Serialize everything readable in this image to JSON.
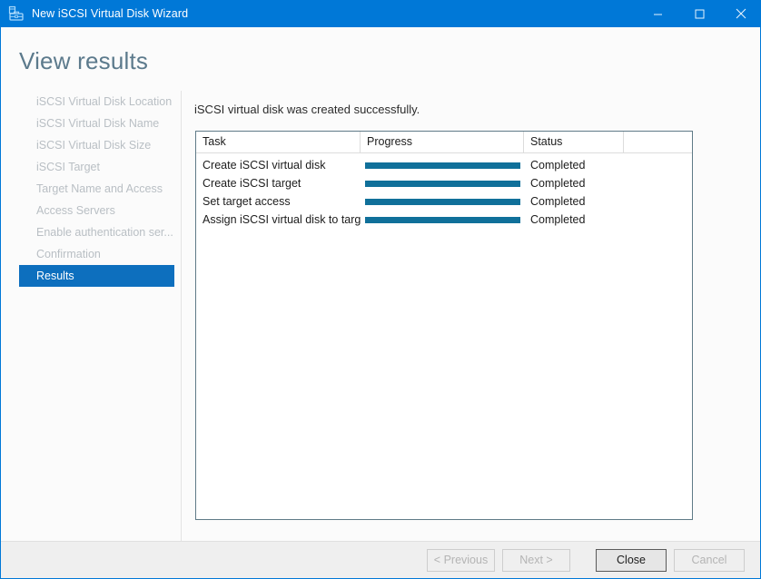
{
  "window": {
    "title": "New iSCSI Virtual Disk Wizard",
    "icon": "iscsi-virtual-disk-icon",
    "minimize_label": "Minimize",
    "maximize_label": "Maximize",
    "close_label": "Close",
    "accent_color": "#0078d7"
  },
  "page": {
    "title": "View results"
  },
  "nav": {
    "items": [
      {
        "label": "iSCSI Virtual Disk Location",
        "selected": false
      },
      {
        "label": "iSCSI Virtual Disk Name",
        "selected": false
      },
      {
        "label": "iSCSI Virtual Disk Size",
        "selected": false
      },
      {
        "label": "iSCSI Target",
        "selected": false
      },
      {
        "label": "Target Name and Access",
        "selected": false
      },
      {
        "label": "Access Servers",
        "selected": false
      },
      {
        "label": "Enable authentication ser...",
        "selected": false
      },
      {
        "label": "Confirmation",
        "selected": false
      },
      {
        "label": "Results",
        "selected": true
      }
    ],
    "selected_color": "#0d6fbe"
  },
  "content": {
    "message": "iSCSI virtual disk was created successfully.",
    "table": {
      "columns": [
        "Task",
        "Progress",
        "Status",
        ""
      ],
      "progress_color": "#10709a",
      "rows": [
        {
          "task": "Create iSCSI virtual disk",
          "progress": 100,
          "status": "Completed",
          "extra": ""
        },
        {
          "task": "Create iSCSI target",
          "progress": 100,
          "status": "Completed",
          "extra": ""
        },
        {
          "task": "Set target access",
          "progress": 100,
          "status": "Completed",
          "extra": ""
        },
        {
          "task": "Assign iSCSI virtual disk to target",
          "progress": 100,
          "status": "Completed",
          "extra": ""
        }
      ]
    }
  },
  "footer": {
    "previous_label": "< Previous",
    "next_label": "Next >",
    "close_label": "Close",
    "cancel_label": "Cancel"
  }
}
